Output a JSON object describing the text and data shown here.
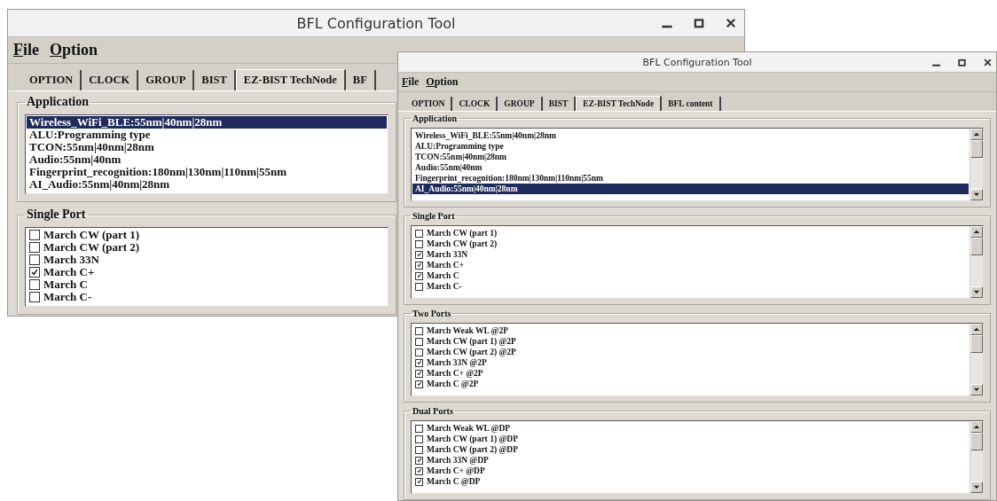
{
  "windows": [
    {
      "title": "BFL Configuration Tool",
      "menu": [
        "File",
        "Option"
      ],
      "tabs": [
        {
          "label": "OPTION",
          "selected": false
        },
        {
          "label": "CLOCK",
          "selected": false
        },
        {
          "label": "GROUP",
          "selected": false
        },
        {
          "label": "BIST",
          "selected": false
        },
        {
          "label": "EZ-BIST TechNode",
          "selected": true
        },
        {
          "label": "BF",
          "selected": false
        }
      ],
      "groups": [
        {
          "title": "Application",
          "kind": "list",
          "items": [
            {
              "label": "Wireless_WiFi_BLE:55nm|40nm|28nm",
              "selected": true
            },
            {
              "label": "ALU:Programming type",
              "selected": false
            },
            {
              "label": "TCON:55nm|40nm|28nm",
              "selected": false
            },
            {
              "label": "Audio:55nm|40nm",
              "selected": false
            },
            {
              "label": "Fingerprint_recognition:180nm|130nm|110nm|55nm",
              "selected": false
            },
            {
              "label": "AI_Audio:55nm|40nm|28nm",
              "selected": false
            }
          ]
        },
        {
          "title": "Single Port",
          "kind": "checklist",
          "items": [
            {
              "label": "March CW (part 1)",
              "checked": false
            },
            {
              "label": "March CW (part 2)",
              "checked": false
            },
            {
              "label": "March 33N",
              "checked": false
            },
            {
              "label": "March C+",
              "checked": true
            },
            {
              "label": "March C",
              "checked": false
            },
            {
              "label": "March C-",
              "checked": false
            }
          ]
        }
      ]
    },
    {
      "title": "BFL Configuration Tool",
      "menu": [
        "File",
        "Option"
      ],
      "tabs": [
        {
          "label": "OPTION",
          "selected": false
        },
        {
          "label": "CLOCK",
          "selected": false
        },
        {
          "label": "GROUP",
          "selected": false
        },
        {
          "label": "BIST",
          "selected": false
        },
        {
          "label": "EZ-BIST TechNode",
          "selected": true
        },
        {
          "label": "BFL content",
          "selected": false
        }
      ],
      "groups": [
        {
          "title": "Application",
          "kind": "list",
          "items": [
            {
              "label": "Wireless_WiFi_BLE:55nm|40nm|28nm",
              "selected": false
            },
            {
              "label": "ALU:Programming type",
              "selected": false
            },
            {
              "label": "TCON:55nm|40nm|28nm",
              "selected": false
            },
            {
              "label": "Audio:55nm|40nm",
              "selected": false
            },
            {
              "label": "Fingerprint_recognition:180nm|130nm|110nm|55nm",
              "selected": false
            },
            {
              "label": "AI_Audio:55nm|40nm|28nm",
              "selected": true
            }
          ]
        },
        {
          "title": "Single Port",
          "kind": "checklist",
          "items": [
            {
              "label": "March CW (part 1)",
              "checked": false
            },
            {
              "label": "March CW (part 2)",
              "checked": false
            },
            {
              "label": "March 33N",
              "checked": true
            },
            {
              "label": "March C+",
              "checked": true
            },
            {
              "label": "March C",
              "checked": true
            },
            {
              "label": "March C-",
              "checked": false
            }
          ]
        },
        {
          "title": "Two Ports",
          "kind": "checklist",
          "items": [
            {
              "label": "March Weak WL @2P",
              "checked": false
            },
            {
              "label": "March CW (part 1) @2P",
              "checked": false
            },
            {
              "label": "March CW (part 2) @2P",
              "checked": false
            },
            {
              "label": "March 33N @2P",
              "checked": true
            },
            {
              "label": "March C+ @2P",
              "checked": true
            },
            {
              "label": "March C @2P",
              "checked": true
            }
          ]
        },
        {
          "title": "Dual Ports",
          "kind": "checklist",
          "items": [
            {
              "label": "March Weak WL @DP",
              "checked": false
            },
            {
              "label": "March CW (part 1) @DP",
              "checked": false
            },
            {
              "label": "March CW (part 2) @DP",
              "checked": false
            },
            {
              "label": "March 33N @DP",
              "checked": true
            },
            {
              "label": "March C+ @DP",
              "checked": true
            },
            {
              "label": "March C @DP",
              "checked": true
            }
          ]
        }
      ]
    }
  ]
}
